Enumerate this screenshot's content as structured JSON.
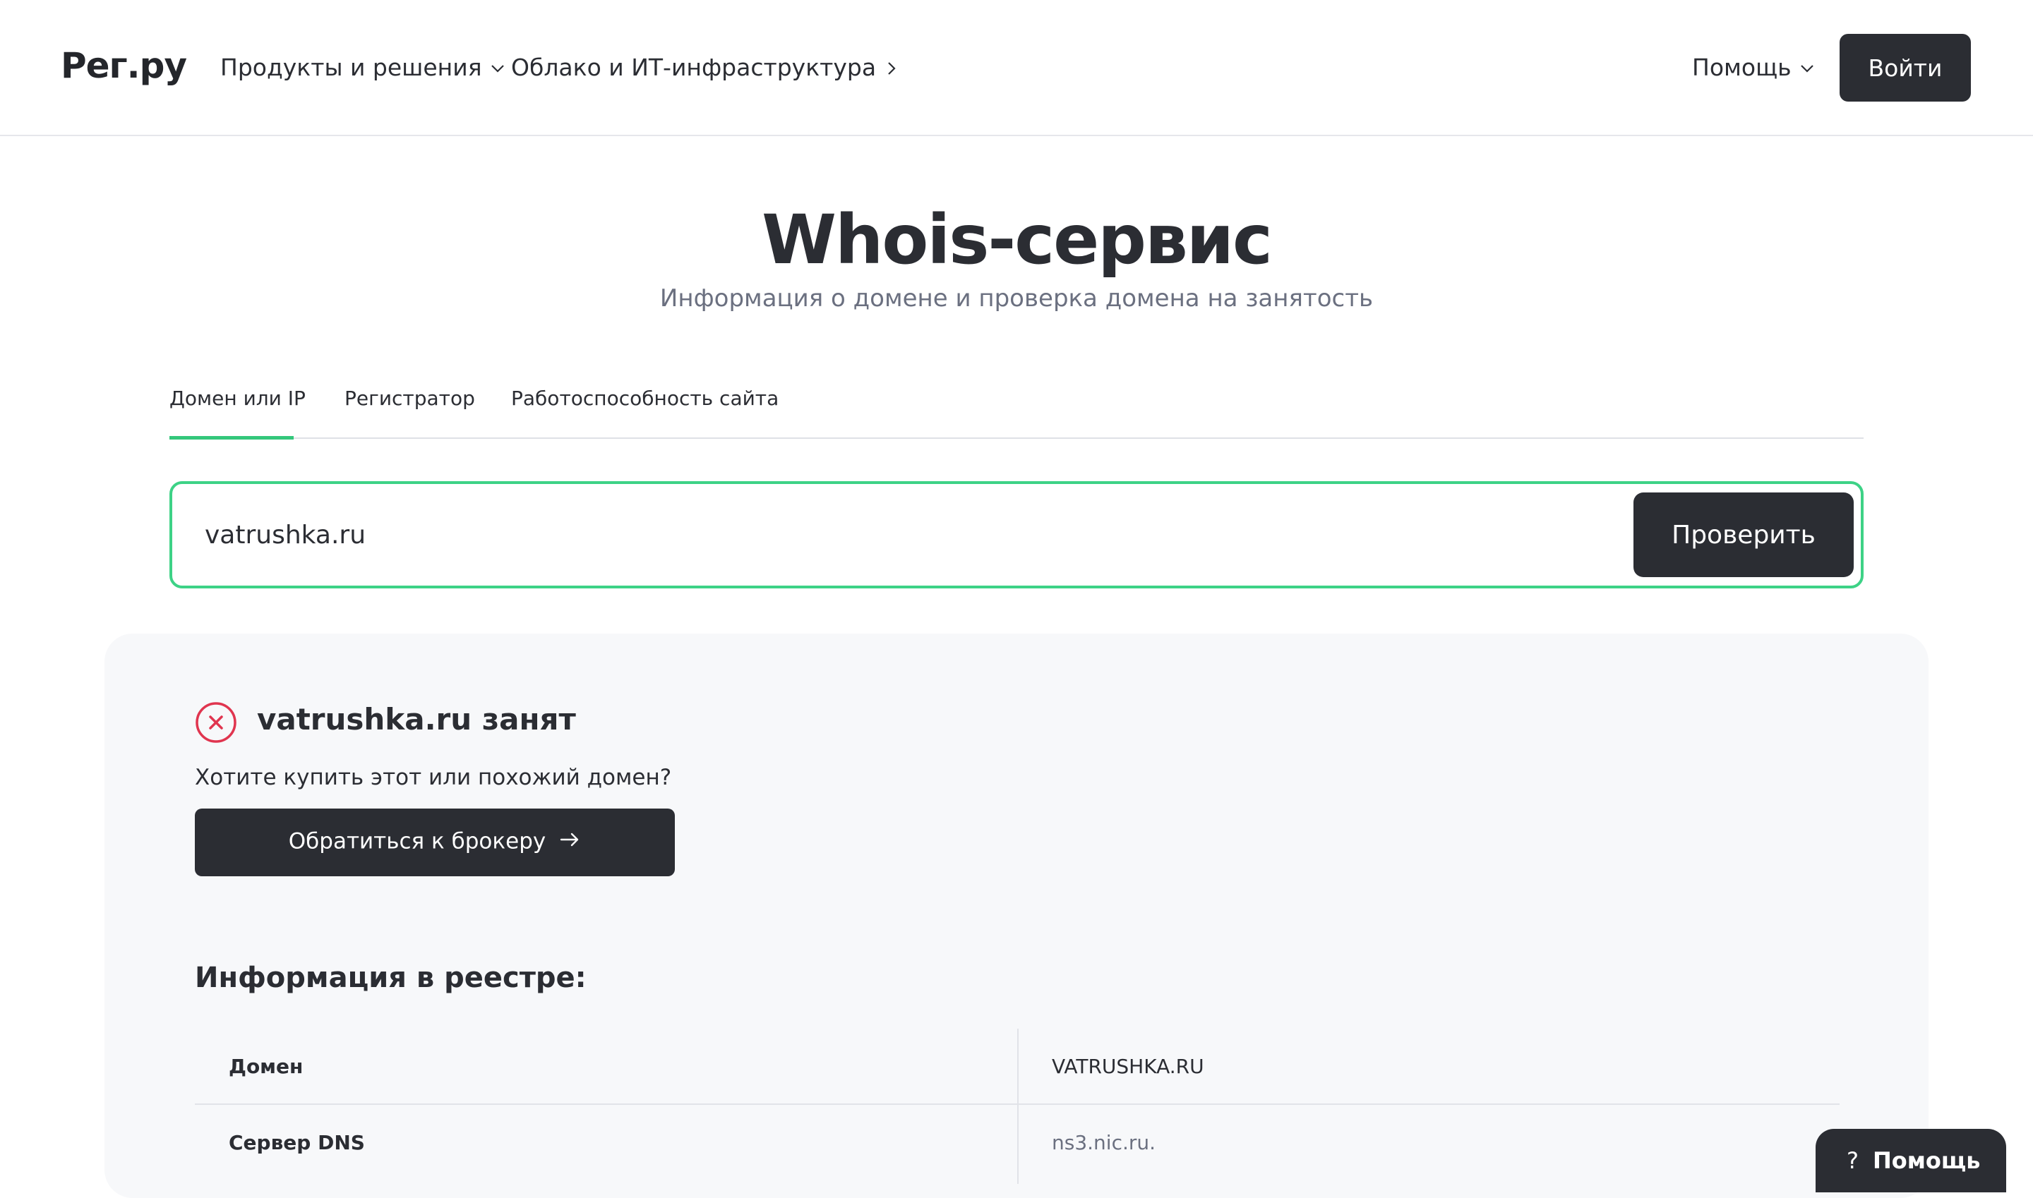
{
  "header": {
    "logo": "Рег.ру",
    "nav": {
      "products": "Продукты и решения",
      "cloud": "Облако и ИТ-инфраструктура",
      "help": "Помощь"
    },
    "login_label": "Войти"
  },
  "hero": {
    "title": "Whois-сервис",
    "subtitle": "Информация о домене и проверка домена на занятость"
  },
  "tabs": [
    {
      "label": "Домен или IP",
      "active": true
    },
    {
      "label": "Регистратор",
      "active": false
    },
    {
      "label": "Работоспособность сайта",
      "active": false
    }
  ],
  "search": {
    "value": "vatrushka.ru",
    "button_label": "Проверить"
  },
  "result": {
    "status_text": "vatrushka.ru занят",
    "buy_question": "Хотите купить этот или похожий домен?",
    "broker_label": "Обратиться к брокеру",
    "registry_title": "Информация в реестре:",
    "rows": [
      {
        "key": "Домен",
        "value": "VATRUSHKA.RU"
      },
      {
        "key": "Сервер DNS",
        "value": "ns3.nic.ru."
      }
    ]
  },
  "help_float": {
    "label": "Помощь",
    "icon_text": "?"
  },
  "colors": {
    "accent_green": "#3dd286",
    "dark": "#2b2d33",
    "error_red": "#e0354f",
    "panel_bg": "#f7f8fa"
  },
  "icons": [
    "chevron-down-icon",
    "chevron-right-icon",
    "error-circle-icon",
    "arrow-right-icon",
    "question-icon"
  ]
}
